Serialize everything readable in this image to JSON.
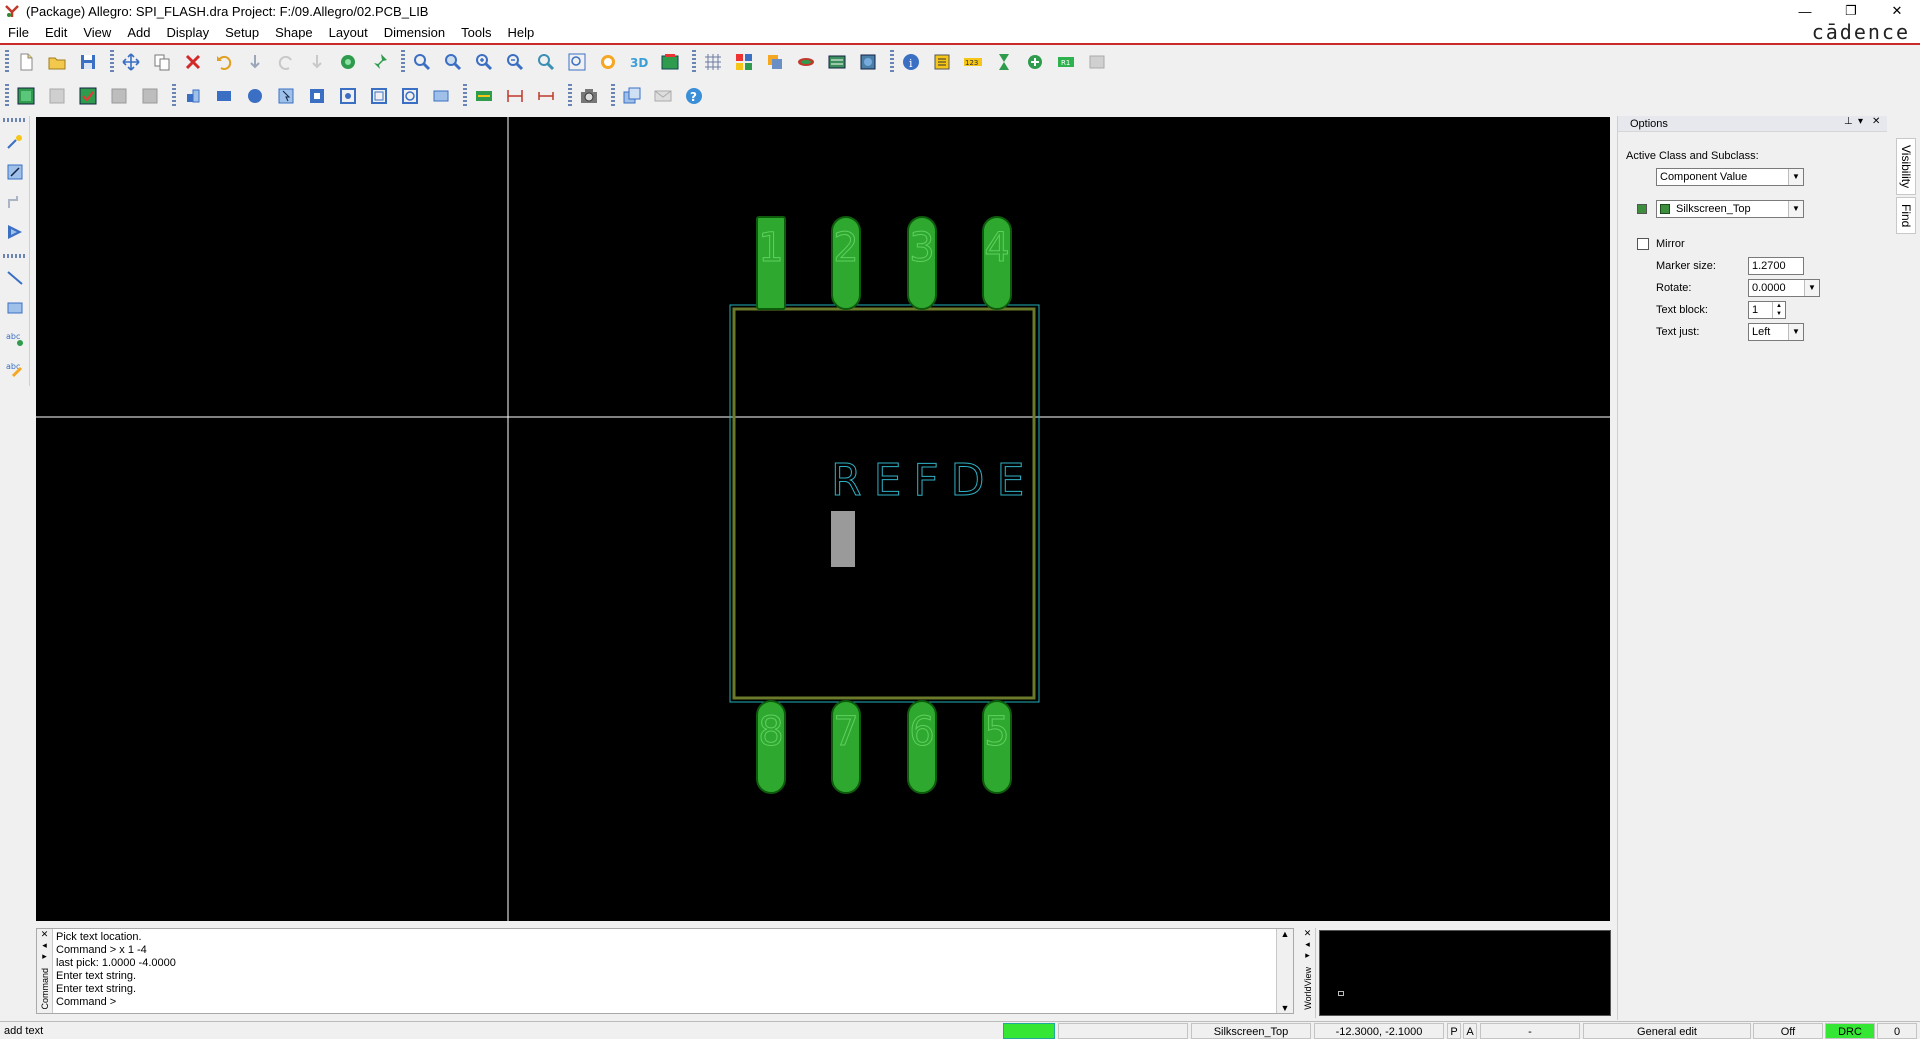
{
  "titlebar": {
    "title": "(Package) Allegro: SPI_FLASH.dra  Project: F:/09.Allegro/02.PCB_LIB",
    "minimize": "—",
    "restore": "❐",
    "close": "✕"
  },
  "brand": "cādence",
  "menu": [
    "File",
    "Edit",
    "View",
    "Add",
    "Display",
    "Setup",
    "Shape",
    "Layout",
    "Dimension",
    "Tools",
    "Help"
  ],
  "canvas": {
    "pins_top": [
      "1",
      "2",
      "3",
      "4"
    ],
    "pins_bottom": [
      "8",
      "7",
      "6",
      "5"
    ],
    "refdes_text": "REFDE",
    "colors": {
      "background": "#000000",
      "pad": "#2fa82f",
      "pad_outline": "#0c5c0c",
      "place_bound": "#1fb1b8",
      "silkscreen": "#6a7a2a",
      "crosshair": "#ffffff",
      "refdes": "#2fb2c7",
      "cursor_block": "#9a9a9a"
    }
  },
  "options": {
    "header": "Options",
    "active_label": "Active Class and Subclass:",
    "class_value": "Component Value",
    "subclass_value": "Silkscreen_Top",
    "mirror_label": "Mirror",
    "marker_size_label": "Marker size:",
    "marker_size_value": "1.2700",
    "rotate_label": "Rotate:",
    "rotate_value": "0.0000",
    "text_block_label": "Text block:",
    "text_block_value": "1",
    "text_just_label": "Text just:",
    "text_just_value": "Left",
    "tabs": [
      "Visibility",
      "Find"
    ]
  },
  "command": {
    "side_label": "Command",
    "lines": [
      "Pick text location.",
      "Command > x 1 -4",
      "last pick:  1.0000  -4.0000",
      "Enter text string.",
      "Enter text string.",
      "Command >"
    ]
  },
  "worldview": {
    "side_label": "WorldView"
  },
  "status": {
    "mode": "add text",
    "subclass": "Silkscreen_Top",
    "coords": "-12.3000, -2.1000",
    "p_flag": "P",
    "a_flag": "A",
    "dash": "-",
    "edit_mode": "General edit",
    "off": "Off",
    "drc": "DRC",
    "count": "0"
  }
}
